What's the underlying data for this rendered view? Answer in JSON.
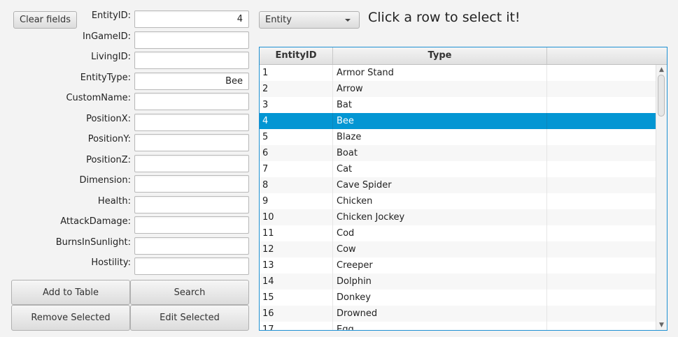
{
  "form": {
    "clear_label": "Clear fields",
    "fields": [
      {
        "label": "EntityID:",
        "value": "4"
      },
      {
        "label": "InGameID:",
        "value": ""
      },
      {
        "label": "LivingID:",
        "value": ""
      },
      {
        "label": "EntityType:",
        "value": "Bee"
      },
      {
        "label": "CustomName:",
        "value": ""
      },
      {
        "label": "PositionX:",
        "value": ""
      },
      {
        "label": "PositionY:",
        "value": ""
      },
      {
        "label": "PositionZ:",
        "value": ""
      },
      {
        "label": "Dimension:",
        "value": ""
      },
      {
        "label": "Health:",
        "value": ""
      },
      {
        "label": "AttackDamage:",
        "value": ""
      },
      {
        "label": "BurnsInSunlight:",
        "value": ""
      },
      {
        "label": "Hostility:",
        "value": ""
      }
    ],
    "actions": {
      "add": "Add to Table",
      "search": "Search",
      "remove": "Remove Selected",
      "edit": "Edit Selected"
    }
  },
  "selector": {
    "selected": "Entity",
    "hint": "Click a row to select it!"
  },
  "table": {
    "columns": [
      "EntityID",
      "Type",
      ""
    ],
    "selected_id": "4",
    "rows": [
      [
        "1",
        "Armor Stand"
      ],
      [
        "2",
        "Arrow"
      ],
      [
        "3",
        "Bat"
      ],
      [
        "4",
        "Bee"
      ],
      [
        "5",
        "Blaze"
      ],
      [
        "6",
        "Boat"
      ],
      [
        "7",
        "Cat"
      ],
      [
        "8",
        "Cave Spider"
      ],
      [
        "9",
        "Chicken"
      ],
      [
        "10",
        "Chicken Jockey"
      ],
      [
        "11",
        "Cod"
      ],
      [
        "12",
        "Cow"
      ],
      [
        "13",
        "Creeper"
      ],
      [
        "14",
        "Dolphin"
      ],
      [
        "15",
        "Donkey"
      ],
      [
        "16",
        "Drowned"
      ],
      [
        "17",
        "Egg"
      ]
    ]
  },
  "icons": {
    "dropdown": "chevron-down-icon",
    "scroll_up": "scroll-up-icon",
    "scroll_down": "scroll-down-icon"
  }
}
